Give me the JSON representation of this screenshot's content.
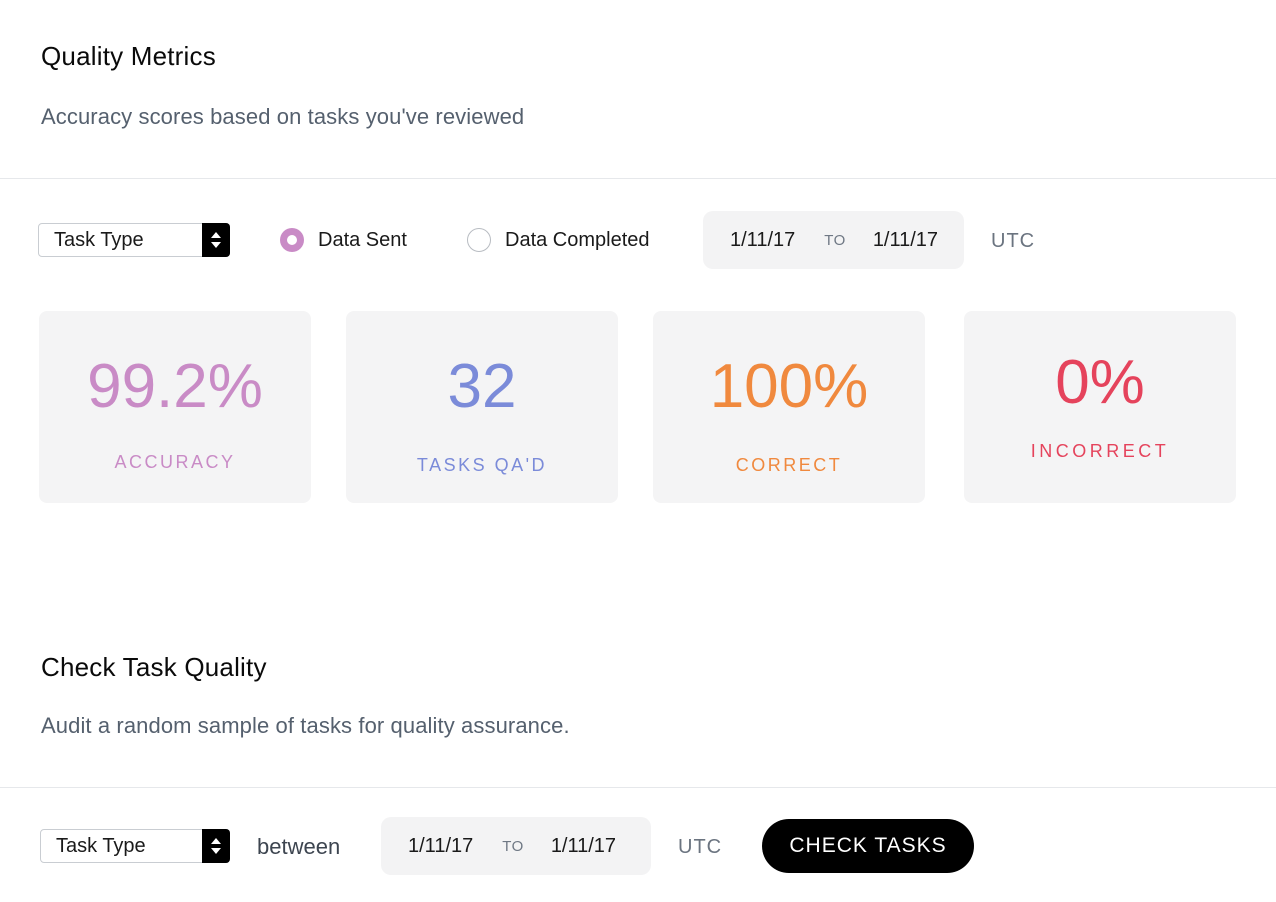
{
  "quality_metrics": {
    "title": "Quality Metrics",
    "subtitle": "Accuracy scores based on tasks you've reviewed",
    "filters": {
      "task_type_select": "Task Type",
      "radio_data_sent": "Data Sent",
      "radio_data_completed": "Data Completed",
      "selected_radio": "Data Sent",
      "date_from": "1/11/17",
      "date_to_label": "TO",
      "date_to": "1/11/17",
      "timezone": "UTC"
    },
    "cards": [
      {
        "value": "99.2%",
        "label": "ACCURACY",
        "color": "#c98bc6"
      },
      {
        "value": "32",
        "label": "TASKS QA'D",
        "color": "#7b8bd9"
      },
      {
        "value": "100%",
        "label": "CORRECT",
        "color": "#f0893e"
      },
      {
        "value": "0%",
        "label": "INCORRECT",
        "color": "#e5435c"
      }
    ]
  },
  "check_task_quality": {
    "title": "Check Task Quality",
    "subtitle": "Audit a random sample of tasks for quality assurance.",
    "filters": {
      "task_type_select": "Task Type",
      "between_label": "between",
      "date_from": "1/11/17",
      "date_to_label": "TO",
      "date_to": "1/11/17",
      "timezone": "UTC"
    },
    "button_label": "CHECK TASKS"
  },
  "icons": {
    "select_arrow": "up-down-caret-icon",
    "radio": "radio-icon"
  }
}
